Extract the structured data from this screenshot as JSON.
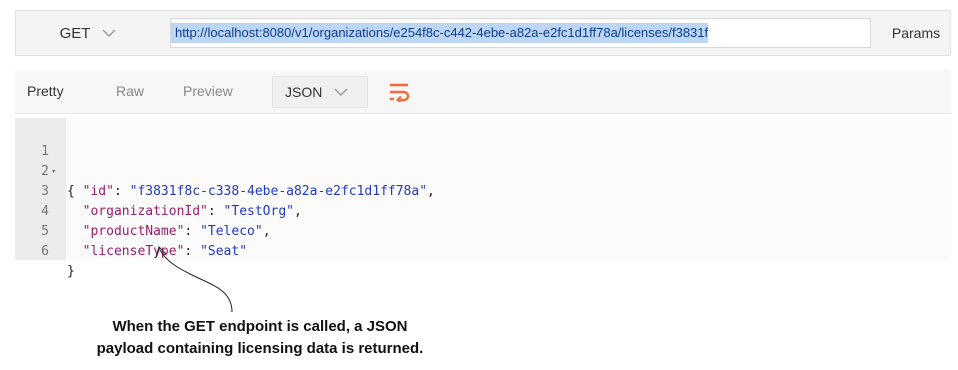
{
  "request": {
    "method": "GET",
    "url": "http://localhost:8080/v1/organizations/e254f8c-c442-4ebe-a82a-e2fc1d1ff78a/licenses/f3831f",
    "params_label": "Params"
  },
  "response": {
    "tabs": [
      {
        "label": "Pretty",
        "active": true
      },
      {
        "label": "Raw",
        "active": false
      },
      {
        "label": "Preview",
        "active": false
      }
    ],
    "format": "JSON"
  },
  "code": {
    "lines": [
      {
        "n": "1",
        "fold": "▾",
        "open": "{"
      },
      {
        "n": "2",
        "key": "\"id\"",
        "value": "\"f3831f8c-c338-4ebe-a82a-e2fc1d1ff78a\"",
        "comma": true
      },
      {
        "n": "3",
        "key": "\"organizationId\"",
        "value": "\"TestOrg\"",
        "comma": true
      },
      {
        "n": "4",
        "key": "\"productName\"",
        "value": "\"Teleco\"",
        "comma": true
      },
      {
        "n": "5",
        "key": "\"licenseType\"",
        "value": "\"Seat\"",
        "comma": false
      },
      {
        "n": "6",
        "close": "}"
      }
    ]
  },
  "annotation": {
    "line1": "When the GET endpoint is called, a JSON",
    "line2": "payload containing licensing data is returned."
  },
  "colors": {
    "url_highlight": "#bcd6f4",
    "wrap_icon": "#f26b3a",
    "json_key": "#9c1c6f",
    "json_string": "#203ac4"
  },
  "icons": [
    "chevron-down-icon",
    "wrap-lines-icon",
    "fold-arrow-icon",
    "callout-arrow-icon"
  ]
}
